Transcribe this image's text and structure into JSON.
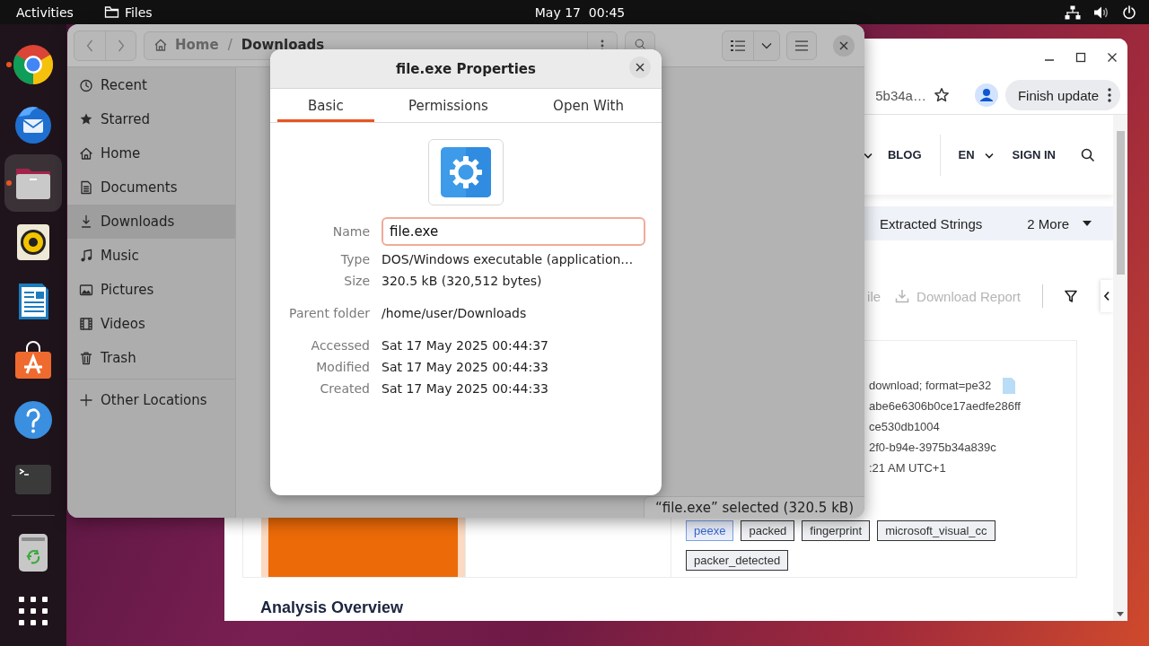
{
  "top_bar": {
    "activities": "Activities",
    "app_name": "Files",
    "clock": "May 17  00:45"
  },
  "dock": {
    "apps": [
      {
        "kind": "chrome",
        "running": true,
        "selected": false
      },
      {
        "kind": "thunderbird",
        "running": false,
        "selected": false
      },
      {
        "kind": "files",
        "running": true,
        "selected": true
      },
      {
        "kind": "rhythmbox",
        "running": false,
        "selected": false
      },
      {
        "kind": "writer",
        "running": false,
        "selected": false
      },
      {
        "kind": "appcenter",
        "running": false,
        "selected": false
      },
      {
        "kind": "help",
        "running": false,
        "selected": false
      },
      {
        "kind": "terminal",
        "running": false,
        "selected": false
      }
    ],
    "extras": [
      {
        "kind": "trash"
      },
      {
        "kind": "apps"
      }
    ]
  },
  "browser": {
    "address": "5b34a…",
    "update_button": "Finish update",
    "nav": [
      {
        "dropdown": true,
        "separated": false
      },
      {
        "label": "BLOG",
        "dropdown": false,
        "separated": false
      },
      {
        "label": "EN",
        "dropdown": true,
        "separated": true
      },
      {
        "label": "SIGN IN",
        "dropdown": false,
        "separated": false
      }
    ],
    "tabs": [
      {
        "label": "Extracted Strings",
        "dropdown": false
      },
      {
        "label": "2 More",
        "dropdown": true
      }
    ],
    "actions": [
      {
        "kind": "text",
        "label": "ile",
        "disabled": true
      },
      {
        "kind": "download",
        "label": "Download Report",
        "disabled": true
      }
    ],
    "details": [
      {
        "text": "download; format=pe32",
        "kind": "file"
      },
      {
        "text": "abe6e6306b0ce17aedfe286ff",
        "kind": "text"
      },
      {
        "text": "ce530db1004",
        "kind": "text"
      },
      {
        "text": "2f0-b94e-3975b34a839c",
        "kind": "text"
      },
      {
        "text": ":21 AM UTC+1",
        "kind": "text"
      }
    ],
    "tags": [
      {
        "label": "peexe",
        "highlighted": true
      },
      {
        "label": "packed",
        "highlighted": false
      },
      {
        "label": "fingerprint",
        "highlighted": false
      },
      {
        "label": "microsoft_visual_cc",
        "highlighted": false
      },
      {
        "label": "packer_detected",
        "highlighted": false
      }
    ],
    "heading": "Analysis Overview"
  },
  "files": {
    "path": [
      {
        "label": "Home",
        "kind": "home",
        "current": false
      },
      {
        "label": "Downloads",
        "kind": "folder",
        "current": true
      }
    ],
    "path_separator": "/",
    "sidebar": [
      {
        "kind": "recent",
        "label": "Recent",
        "selected": false
      },
      {
        "kind": "starred",
        "label": "Starred",
        "selected": false
      },
      {
        "kind": "home",
        "label": "Home",
        "selected": false
      },
      {
        "kind": "documents",
        "label": "Documents",
        "selected": false
      },
      {
        "kind": "downloads",
        "label": "Downloads",
        "selected": true
      },
      {
        "kind": "music",
        "label": "Music",
        "selected": false
      },
      {
        "kind": "pictures",
        "label": "Pictures",
        "selected": false
      },
      {
        "kind": "videos",
        "label": "Videos",
        "selected": false
      },
      {
        "kind": "trash",
        "label": "Trash",
        "selected": false
      }
    ],
    "other_locations": "Other Locations",
    "status": "“file.exe” selected (320.5 kB)"
  },
  "dialog": {
    "title": "file.exe Properties",
    "tabs": [
      {
        "label": "Basic",
        "selected": true
      },
      {
        "label": "Permissions",
        "selected": false
      },
      {
        "label": "Open With",
        "selected": false
      }
    ],
    "name": {
      "label": "Name",
      "value": "file.exe"
    },
    "field_groups": [
      [
        {
          "label": "Type",
          "value": "DOS/Windows executable (application…"
        },
        {
          "label": "Size",
          "value": "320.5 kB (320,512 bytes)"
        }
      ],
      [
        {
          "label": "Parent folder",
          "value": "/home/user/Downloads"
        }
      ],
      [
        {
          "label": "Accessed",
          "value": "Sat 17 May 2025 00:44:37"
        },
        {
          "label": "Modified",
          "value": "Sat 17 May 2025 00:44:33"
        },
        {
          "label": "Created",
          "value": "Sat 17 May 2025 00:44:33"
        }
      ]
    ]
  }
}
